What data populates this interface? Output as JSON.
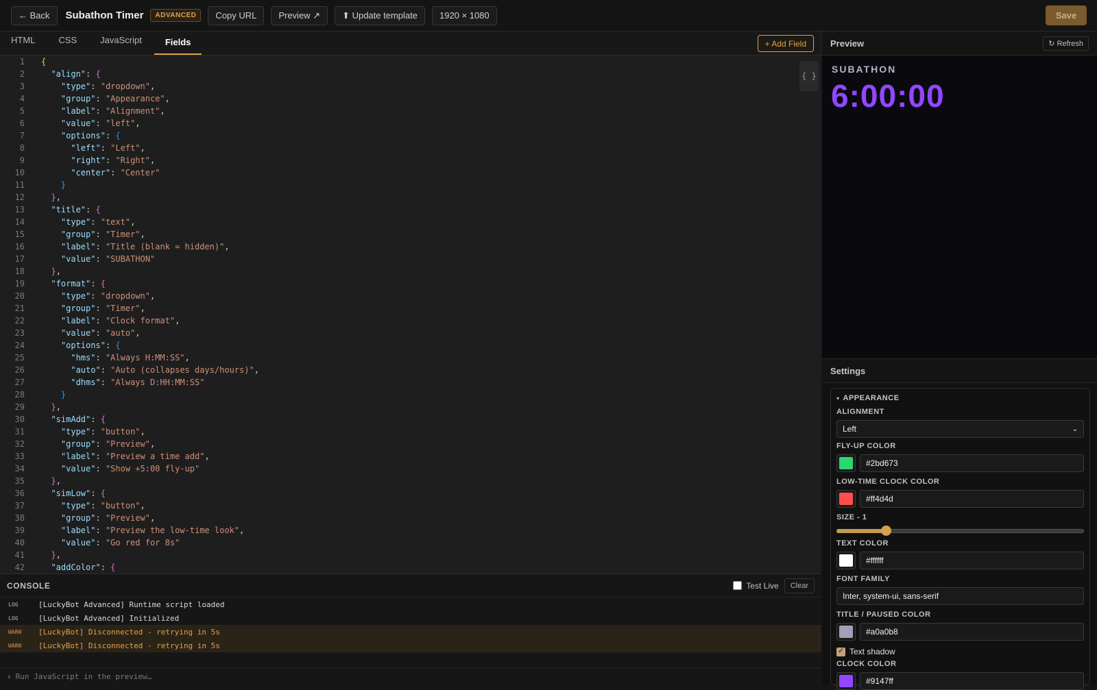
{
  "topbar": {
    "back_label": "← Back",
    "title": "Subathon Timer",
    "badge": "ADVANCED",
    "copy_url_label": "Copy URL",
    "preview_label": "Preview ↗",
    "update_label": "⬆ Update template",
    "resolution": "1920 × 1080",
    "save_label": "Save"
  },
  "editor": {
    "tabs": [
      {
        "label": "HTML",
        "active": false
      },
      {
        "label": "CSS",
        "active": false
      },
      {
        "label": "JavaScript",
        "active": false
      },
      {
        "label": "Fields",
        "active": true
      }
    ],
    "add_field_label": "+ Add Field",
    "fold_icon": "{ }",
    "lines": [
      [
        {
          "t": "{",
          "c": "b1"
        }
      ],
      [
        {
          "t": "  "
        },
        {
          "t": "\"align\"",
          "c": "k"
        },
        {
          "t": ": "
        },
        {
          "t": "{",
          "c": "b2"
        }
      ],
      [
        {
          "t": "    "
        },
        {
          "t": "\"type\"",
          "c": "k"
        },
        {
          "t": ": "
        },
        {
          "t": "\"dropdown\"",
          "c": "s"
        },
        {
          "t": ","
        }
      ],
      [
        {
          "t": "    "
        },
        {
          "t": "\"group\"",
          "c": "k"
        },
        {
          "t": ": "
        },
        {
          "t": "\"Appearance\"",
          "c": "s"
        },
        {
          "t": ","
        }
      ],
      [
        {
          "t": "    "
        },
        {
          "t": "\"label\"",
          "c": "k"
        },
        {
          "t": ": "
        },
        {
          "t": "\"Alignment\"",
          "c": "s"
        },
        {
          "t": ","
        }
      ],
      [
        {
          "t": "    "
        },
        {
          "t": "\"value\"",
          "c": "k"
        },
        {
          "t": ": "
        },
        {
          "t": "\"left\"",
          "c": "s"
        },
        {
          "t": ","
        }
      ],
      [
        {
          "t": "    "
        },
        {
          "t": "\"options\"",
          "c": "k"
        },
        {
          "t": ": "
        },
        {
          "t": "{",
          "c": "b3"
        }
      ],
      [
        {
          "t": "      "
        },
        {
          "t": "\"left\"",
          "c": "k"
        },
        {
          "t": ": "
        },
        {
          "t": "\"Left\"",
          "c": "s"
        },
        {
          "t": ","
        }
      ],
      [
        {
          "t": "      "
        },
        {
          "t": "\"right\"",
          "c": "k"
        },
        {
          "t": ": "
        },
        {
          "t": "\"Right\"",
          "c": "s"
        },
        {
          "t": ","
        }
      ],
      [
        {
          "t": "      "
        },
        {
          "t": "\"center\"",
          "c": "k"
        },
        {
          "t": ": "
        },
        {
          "t": "\"Center\"",
          "c": "s"
        }
      ],
      [
        {
          "t": "    "
        },
        {
          "t": "}",
          "c": "b3"
        }
      ],
      [
        {
          "t": "  "
        },
        {
          "t": "}",
          "c": "b2"
        },
        {
          "t": ","
        }
      ],
      [
        {
          "t": "  "
        },
        {
          "t": "\"title\"",
          "c": "k"
        },
        {
          "t": ": "
        },
        {
          "t": "{",
          "c": "b2"
        }
      ],
      [
        {
          "t": "    "
        },
        {
          "t": "\"type\"",
          "c": "k"
        },
        {
          "t": ": "
        },
        {
          "t": "\"text\"",
          "c": "s"
        },
        {
          "t": ","
        }
      ],
      [
        {
          "t": "    "
        },
        {
          "t": "\"group\"",
          "c": "k"
        },
        {
          "t": ": "
        },
        {
          "t": "\"Timer\"",
          "c": "s"
        },
        {
          "t": ","
        }
      ],
      [
        {
          "t": "    "
        },
        {
          "t": "\"label\"",
          "c": "k"
        },
        {
          "t": ": "
        },
        {
          "t": "\"Title (blank = hidden)\"",
          "c": "s"
        },
        {
          "t": ","
        }
      ],
      [
        {
          "t": "    "
        },
        {
          "t": "\"value\"",
          "c": "k"
        },
        {
          "t": ": "
        },
        {
          "t": "\"SUBATHON\"",
          "c": "s"
        }
      ],
      [
        {
          "t": "  "
        },
        {
          "t": "}",
          "c": "b2"
        },
        {
          "t": ","
        }
      ],
      [
        {
          "t": "  "
        },
        {
          "t": "\"format\"",
          "c": "k"
        },
        {
          "t": ": "
        },
        {
          "t": "{",
          "c": "b2"
        }
      ],
      [
        {
          "t": "    "
        },
        {
          "t": "\"type\"",
          "c": "k"
        },
        {
          "t": ": "
        },
        {
          "t": "\"dropdown\"",
          "c": "s"
        },
        {
          "t": ","
        }
      ],
      [
        {
          "t": "    "
        },
        {
          "t": "\"group\"",
          "c": "k"
        },
        {
          "t": ": "
        },
        {
          "t": "\"Timer\"",
          "c": "s"
        },
        {
          "t": ","
        }
      ],
      [
        {
          "t": "    "
        },
        {
          "t": "\"label\"",
          "c": "k"
        },
        {
          "t": ": "
        },
        {
          "t": "\"Clock format\"",
          "c": "s"
        },
        {
          "t": ","
        }
      ],
      [
        {
          "t": "    "
        },
        {
          "t": "\"value\"",
          "c": "k"
        },
        {
          "t": ": "
        },
        {
          "t": "\"auto\"",
          "c": "s"
        },
        {
          "t": ","
        }
      ],
      [
        {
          "t": "    "
        },
        {
          "t": "\"options\"",
          "c": "k"
        },
        {
          "t": ": "
        },
        {
          "t": "{",
          "c": "b3"
        }
      ],
      [
        {
          "t": "      "
        },
        {
          "t": "\"hms\"",
          "c": "k"
        },
        {
          "t": ": "
        },
        {
          "t": "\"Always H:MM:SS\"",
          "c": "s"
        },
        {
          "t": ","
        }
      ],
      [
        {
          "t": "      "
        },
        {
          "t": "\"auto\"",
          "c": "k"
        },
        {
          "t": ": "
        },
        {
          "t": "\"Auto (collapses days/hours)\"",
          "c": "s"
        },
        {
          "t": ","
        }
      ],
      [
        {
          "t": "      "
        },
        {
          "t": "\"dhms\"",
          "c": "k"
        },
        {
          "t": ": "
        },
        {
          "t": "\"Always D:HH:MM:SS\"",
          "c": "s"
        }
      ],
      [
        {
          "t": "    "
        },
        {
          "t": "}",
          "c": "b3"
        }
      ],
      [
        {
          "t": "  "
        },
        {
          "t": "}",
          "c": "b2"
        },
        {
          "t": ","
        }
      ],
      [
        {
          "t": "  "
        },
        {
          "t": "\"simAdd\"",
          "c": "k"
        },
        {
          "t": ": "
        },
        {
          "t": "{",
          "c": "b2"
        }
      ],
      [
        {
          "t": "    "
        },
        {
          "t": "\"type\"",
          "c": "k"
        },
        {
          "t": ": "
        },
        {
          "t": "\"button\"",
          "c": "s"
        },
        {
          "t": ","
        }
      ],
      [
        {
          "t": "    "
        },
        {
          "t": "\"group\"",
          "c": "k"
        },
        {
          "t": ": "
        },
        {
          "t": "\"Preview\"",
          "c": "s"
        },
        {
          "t": ","
        }
      ],
      [
        {
          "t": "    "
        },
        {
          "t": "\"label\"",
          "c": "k"
        },
        {
          "t": ": "
        },
        {
          "t": "\"Preview a time add\"",
          "c": "s"
        },
        {
          "t": ","
        }
      ],
      [
        {
          "t": "    "
        },
        {
          "t": "\"value\"",
          "c": "k"
        },
        {
          "t": ": "
        },
        {
          "t": "\"Show +5:00 fly-up\"",
          "c": "s"
        }
      ],
      [
        {
          "t": "  "
        },
        {
          "t": "}",
          "c": "b2"
        },
        {
          "t": ","
        }
      ],
      [
        {
          "t": "  "
        },
        {
          "t": "\"simLow\"",
          "c": "k"
        },
        {
          "t": ": "
        },
        {
          "t": "{",
          "c": "b2"
        }
      ],
      [
        {
          "t": "    "
        },
        {
          "t": "\"type\"",
          "c": "k"
        },
        {
          "t": ": "
        },
        {
          "t": "\"button\"",
          "c": "s"
        },
        {
          "t": ","
        }
      ],
      [
        {
          "t": "    "
        },
        {
          "t": "\"group\"",
          "c": "k"
        },
        {
          "t": ": "
        },
        {
          "t": "\"Preview\"",
          "c": "s"
        },
        {
          "t": ","
        }
      ],
      [
        {
          "t": "    "
        },
        {
          "t": "\"label\"",
          "c": "k"
        },
        {
          "t": ": "
        },
        {
          "t": "\"Preview the low-time look\"",
          "c": "s"
        },
        {
          "t": ","
        }
      ],
      [
        {
          "t": "    "
        },
        {
          "t": "\"value\"",
          "c": "k"
        },
        {
          "t": ": "
        },
        {
          "t": "\"Go red for 8s\"",
          "c": "s"
        }
      ],
      [
        {
          "t": "  "
        },
        {
          "t": "}",
          "c": "b2"
        },
        {
          "t": ","
        }
      ],
      [
        {
          "t": "  "
        },
        {
          "t": "\"addColor\"",
          "c": "k"
        },
        {
          "t": ": "
        },
        {
          "t": "{",
          "c": "b2"
        }
      ]
    ]
  },
  "console": {
    "title": "CONSOLE",
    "test_live_label": "Test Live",
    "clear_label": "Clear",
    "logs": [
      {
        "level": "LOG",
        "text": "[LuckyBot Advanced] Runtime script loaded",
        "kind": "log"
      },
      {
        "level": "LOG",
        "text": "[LuckyBot Advanced] Initialized",
        "kind": "log"
      },
      {
        "level": "WARN",
        "text": "[LuckyBot] Disconnected - retrying in 5s",
        "kind": "warn"
      },
      {
        "level": "WARN",
        "text": "[LuckyBot] Disconnected - retrying in 5s",
        "kind": "warn"
      }
    ],
    "input_placeholder": "Run JavaScript in the preview…"
  },
  "preview": {
    "header": "Preview",
    "refresh_label": "↻ Refresh",
    "subtitle": "SUBATHON",
    "clock": "6:00:00",
    "clock_color": "#9147ff"
  },
  "settings": {
    "header": "Settings",
    "group": "APPEARANCE",
    "alignment_label": "ALIGNMENT",
    "alignment_value": "Left",
    "flyup_label": "FLY-UP COLOR",
    "flyup_value": "#2bd673",
    "lowtime_label": "LOW-TIME CLOCK COLOR",
    "lowtime_value": "#ff4d4d",
    "size_label": "SIZE - 1",
    "size_fraction": 0.2,
    "text_color_label": "TEXT COLOR",
    "text_color_value": "#ffffff",
    "font_family_label": "FONT FAMILY",
    "font_family_value": "Inter, system-ui, sans-serif",
    "title_color_label": "TITLE / PAUSED COLOR",
    "title_color_value": "#a0a0b8",
    "shadow_label": "Text shadow",
    "clock_color_label": "CLOCK COLOR",
    "clock_color_value": "#9147ff"
  }
}
